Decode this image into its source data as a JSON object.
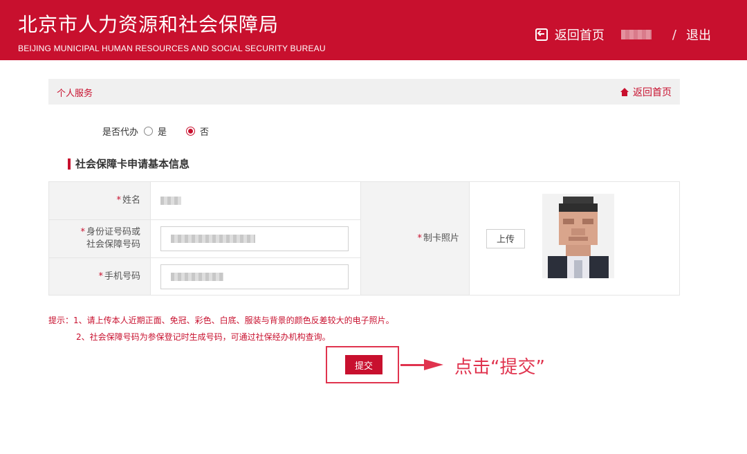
{
  "header": {
    "title": "北京市人力资源和社会保障局",
    "subtitle": "BEIJING MUNICIPAL HUMAN RESOURCES AND SOCIAL SECURITY BUREAU",
    "home_link": "返回首页",
    "separator": "/",
    "logout": "退出"
  },
  "breadcrumb": {
    "section": "个人服务",
    "home_link": "返回首页"
  },
  "proxy": {
    "label": "是否代办",
    "options": [
      "是",
      "否"
    ],
    "selected": "否"
  },
  "section_title": "社会保障卡申请基本信息",
  "form": {
    "required_mark": "*",
    "name_label": "姓名",
    "id_label_line1": "身份证号码或",
    "id_label_line2": "社会保障号码",
    "phone_label": "手机号码",
    "photo_label": "制卡照片",
    "upload_button": "上传"
  },
  "tips": {
    "line1": "提示：1、请上传本人近期正面、免冠、彩色、白底、服装与背景的颜色反差较大的电子照片。",
    "line2": "2、社会保障号码为参保登记时生成号码，可通过社保经办机构查询。"
  },
  "submit_button": "提交",
  "annotation": "点击“提交”",
  "colors": {
    "brand": "#c8102e",
    "annotation": "#e0334e"
  }
}
